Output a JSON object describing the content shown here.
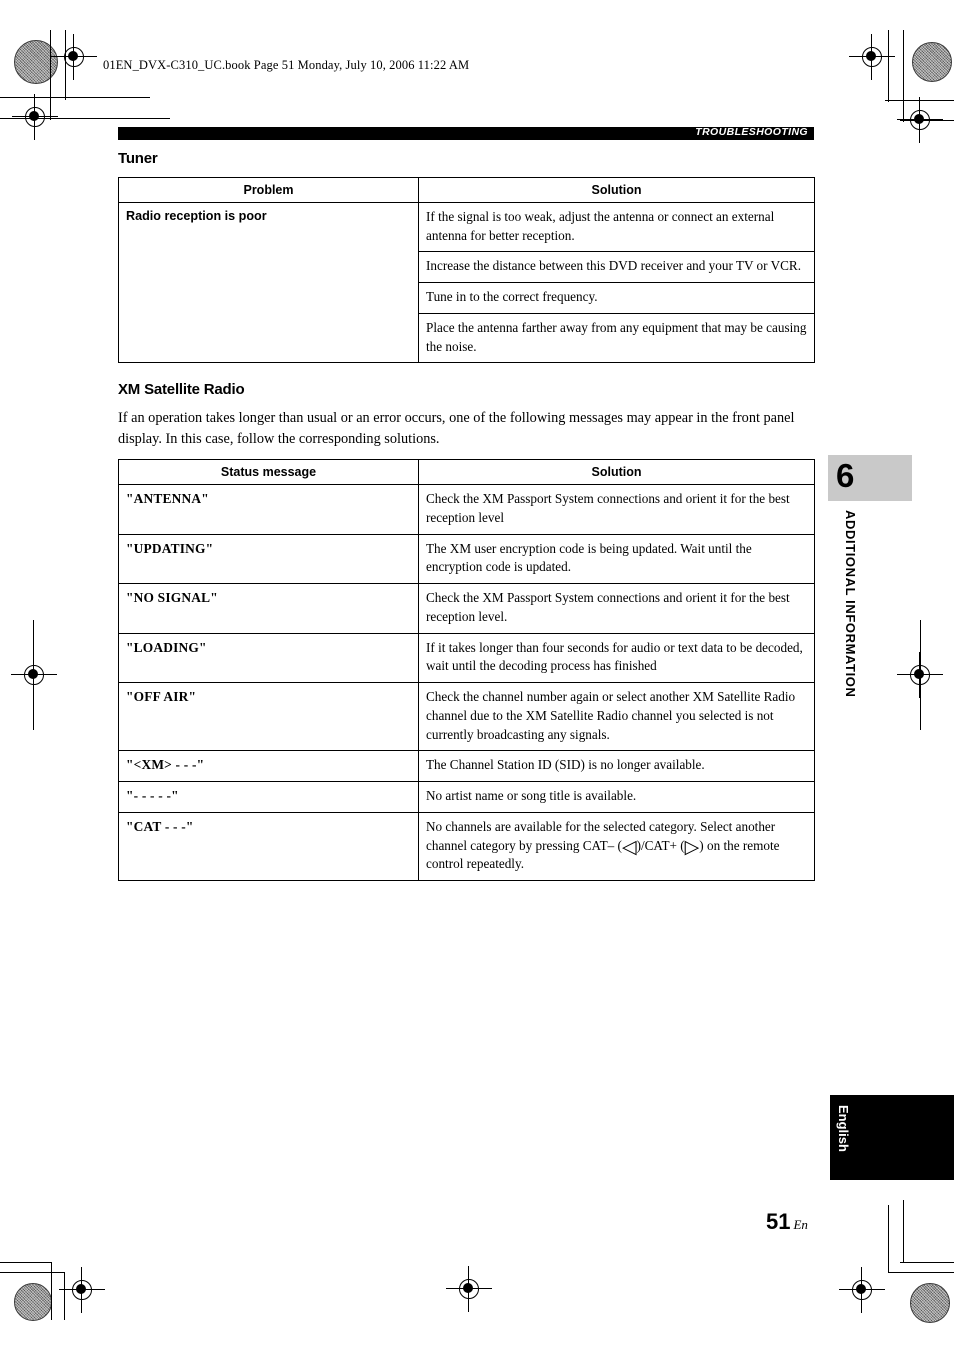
{
  "print_marks": {
    "file_info": "01EN_DVX-C310_UC.book  Page 51  Monday, July 10, 2006  11:22 AM"
  },
  "running_head": {
    "label": "TROUBLESHOOTING"
  },
  "sections": {
    "tuner": {
      "heading": "Tuner",
      "table": {
        "headers": [
          "Problem",
          "Solution"
        ],
        "problem": "Radio reception is poor",
        "solutions": [
          "If the signal is too weak, adjust the antenna or connect an external antenna for better reception.",
          "Increase the distance between this DVD receiver and your TV or VCR.",
          "Tune in to the correct frequency.",
          "Place the antenna farther away from any equipment that may be causing the noise."
        ]
      }
    },
    "xm": {
      "heading": "XM Satellite Radio",
      "intro": "If an operation takes longer than usual or an error occurs, one of the following messages may appear in the front panel display. In this case, follow the corresponding solutions.",
      "table": {
        "headers": [
          "Status message",
          "Solution"
        ],
        "rows": [
          {
            "status": "\"ANTENNA\"",
            "solution": "Check the XM Passport System connections and orient it for the best reception level"
          },
          {
            "status": "\"UPDATING\"",
            "solution": "The XM user encryption code is being updated. Wait until the encryption code is updated."
          },
          {
            "status": "\"NO SIGNAL\"",
            "solution": "Check the XM Passport System connections and orient it for the best reception level."
          },
          {
            "status": "\"LOADING\"",
            "solution": "If it takes longer than four seconds for audio or text data to be decoded, wait until the decoding process has finished"
          },
          {
            "status": "\"OFF AIR\"",
            "solution": "Check the channel number again or select another XM Satellite Radio channel due to the XM Satellite Radio channel you selected is not currently broadcasting any signals."
          },
          {
            "status": "\"<XM> - - -\"",
            "solution": "The Channel Station ID (SID) is no longer available."
          },
          {
            "status": "\"- - - - -\"",
            "solution": "No artist name or song title is available."
          },
          {
            "status": "\"CAT - - -\"",
            "solution_part1": "No channels are available for the selected category. Select another channel category by pressing CAT– (",
            "solution_icon_left": "◁",
            "solution_part2": ")/CAT+ (",
            "solution_icon_right": "▷",
            "solution_part3": ") on the remote control repeatedly."
          }
        ]
      }
    }
  },
  "chapter_tab": {
    "number": "6",
    "name": "ADDITIONAL INFORMATION"
  },
  "language_tab": {
    "label": "English"
  },
  "folio": {
    "page_number": "51",
    "suffix": "En"
  }
}
